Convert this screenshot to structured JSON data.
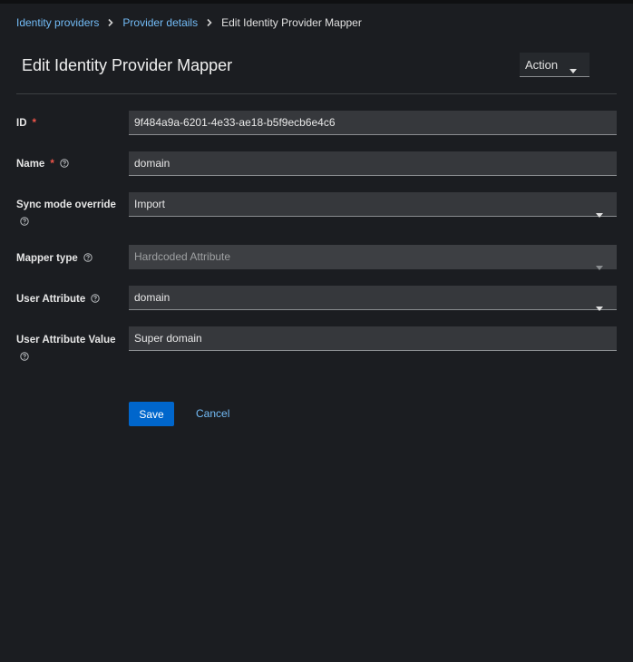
{
  "breadcrumb": {
    "items": [
      {
        "label": "Identity providers"
      },
      {
        "label": "Provider details"
      },
      {
        "label": "Edit Identity Provider Mapper"
      }
    ]
  },
  "header": {
    "title": "Edit Identity Provider Mapper",
    "action_label": "Action"
  },
  "form": {
    "id": {
      "label": "ID",
      "required_mark": "*",
      "value": "9f484a9a-6201-4e33-ae18-b5f9ecb6e4c6"
    },
    "name": {
      "label": "Name",
      "required_mark": "*",
      "value": "domain"
    },
    "sync_mode": {
      "label": "Sync mode override",
      "value": "Import"
    },
    "mapper_type": {
      "label": "Mapper type",
      "value": "Hardcoded Attribute"
    },
    "user_attribute": {
      "label": "User Attribute",
      "value": "domain"
    },
    "user_attribute_value": {
      "label": "User Attribute Value",
      "value": "Super domain"
    }
  },
  "actions": {
    "save_label": "Save",
    "cancel_label": "Cancel"
  },
  "colors": {
    "background": "#1b1d21",
    "primary": "#0066cc",
    "link": "#73bcf7",
    "required": "#f0554a"
  },
  "icons": {
    "breadcrumb_separator": "chevron-right-icon",
    "dropdown": "caret-down-icon",
    "help": "question-circle-icon"
  }
}
